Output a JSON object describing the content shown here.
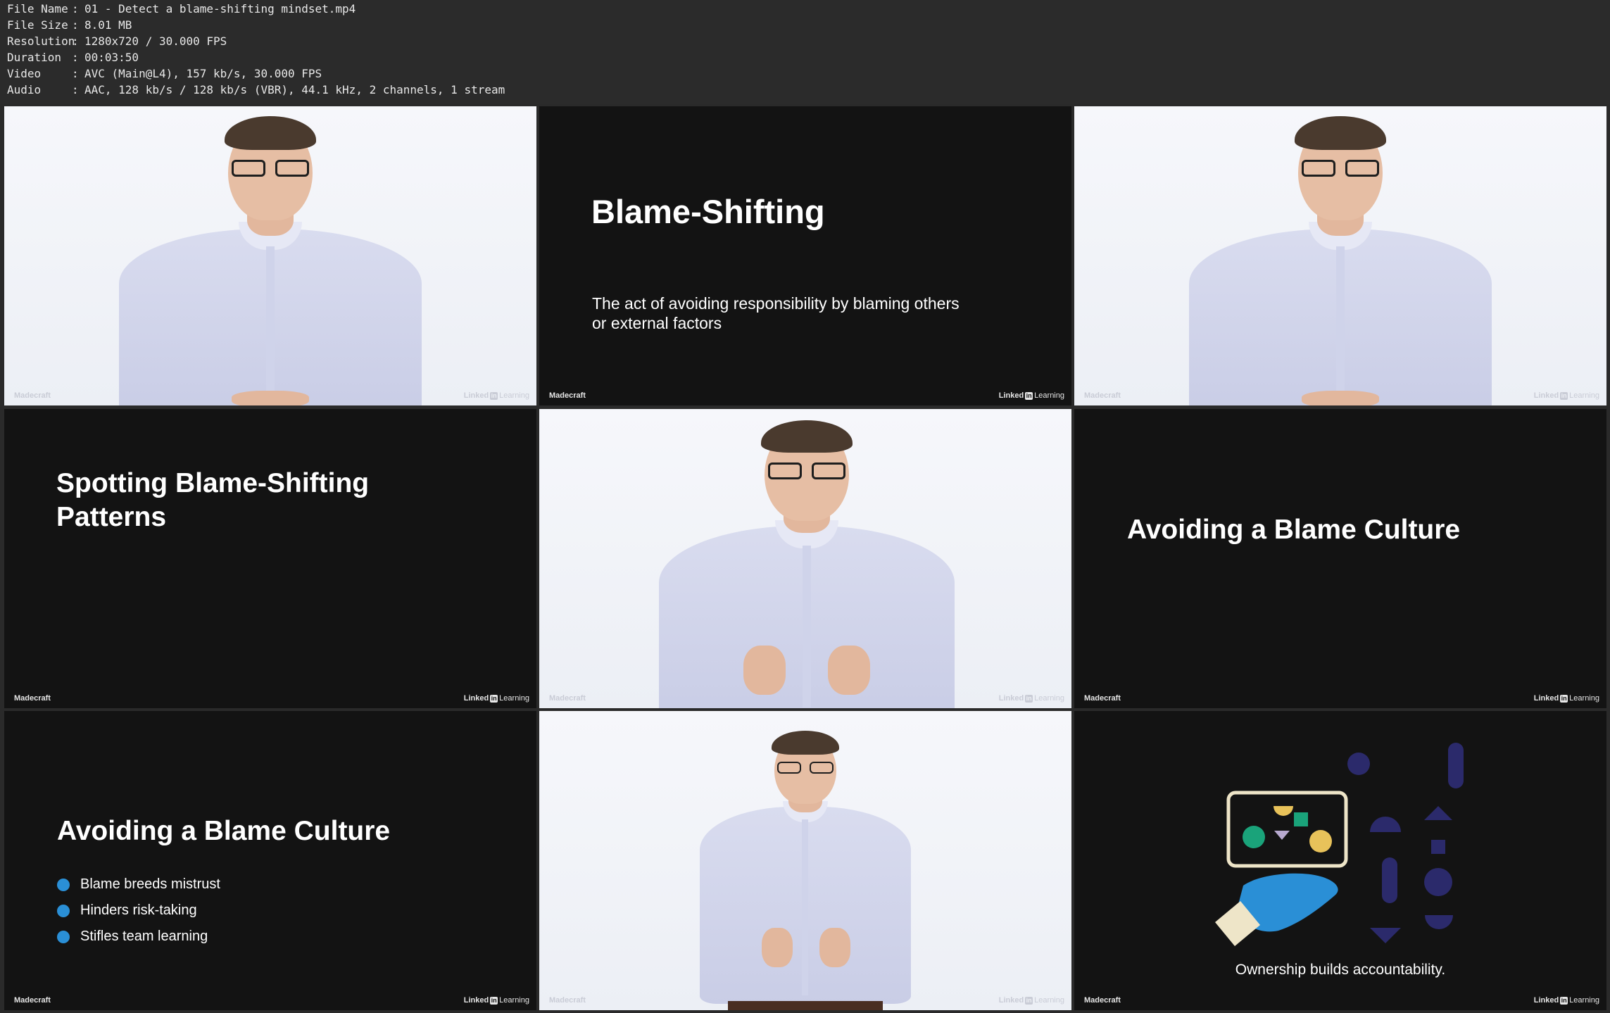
{
  "file_info": [
    {
      "key": "File Name",
      "value": "01 - Detect a blame-shifting mindset.mp4"
    },
    {
      "key": "File Size",
      "value": "8.01 MB"
    },
    {
      "key": "Resolution",
      "value": "1280x720 / 30.000 FPS"
    },
    {
      "key": "Duration",
      "value": "00:03:50"
    },
    {
      "key": "Video",
      "value": "AVC (Main@L4), 157 kb/s, 30.000 FPS"
    },
    {
      "key": "Audio",
      "value": "AAC, 128 kb/s / 128 kb/s (VBR), 44.1 kHz, 2 channels, 1 stream"
    }
  ],
  "separator": ":",
  "branding": {
    "left": "Madecraft",
    "right_word": "Linked",
    "right_in": "in",
    "right_suffix": "Learning"
  },
  "slides": {
    "blame_shifting": {
      "title": "Blame-Shifting",
      "definition_line1": "The act of avoiding responsibility by blaming others",
      "definition_line2": "or external factors"
    },
    "spotting": {
      "line1": "Spotting Blame-Shifting",
      "line2": "Patterns"
    },
    "avoiding_title": {
      "title": "Avoiding a Blame Culture"
    },
    "avoiding_bullets": {
      "title": "Avoiding a Blame Culture",
      "bullets": [
        "Blame breeds mistrust",
        "Hinders risk-taking",
        "Stifles team learning"
      ]
    },
    "ownership": {
      "caption": "Ownership builds accountability."
    }
  },
  "colors": {
    "bullet": "#2a8fd6",
    "slide_bg": "#131313",
    "navy": "#2b2a6b",
    "hand_blue": "#2a8fd6",
    "green": "#1aa37a",
    "yellow": "#e8c25a"
  }
}
